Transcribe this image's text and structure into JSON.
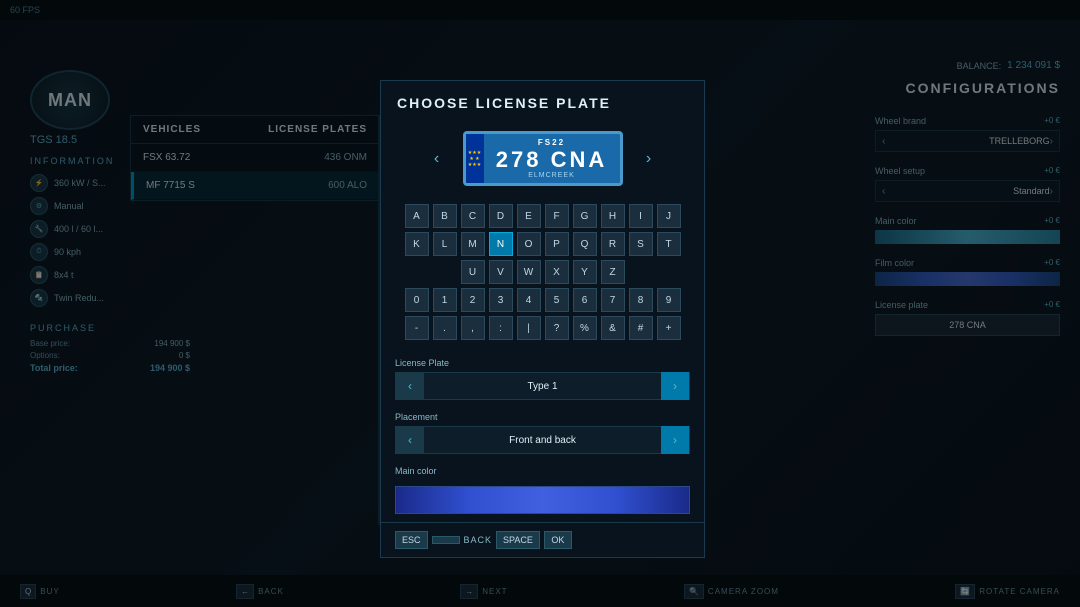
{
  "app": {
    "fps_label": "60 FPS"
  },
  "balance": {
    "label": "BALANCE:",
    "amount": "1 234 091 $"
  },
  "truck": {
    "brand": "MAN",
    "model": "TGS 18.5",
    "info_title": "INFORMATION",
    "specs": [
      {
        "icon": "⚡",
        "text": "360 kW / S..."
      },
      {
        "icon": "⚙",
        "text": "Manual"
      },
      {
        "icon": "🔧",
        "text": "400 l / 60 l..."
      },
      {
        "icon": "⏱",
        "text": "90 kph"
      },
      {
        "icon": "📋",
        "text": "8x4 t"
      },
      {
        "icon": "🔩",
        "text": "Twin Redu..."
      }
    ],
    "purchase_title": "PURCHASE",
    "base_price_label": "Base price:",
    "base_price_value": "194 900 $",
    "options_label": "Options:",
    "options_value": "0 $",
    "total_label": "Total price:",
    "total_value": "194 900 $"
  },
  "vehicles_panel": {
    "col_vehicles": "VEHICLES",
    "col_license_plates": "LICENSE PLATES",
    "rows": [
      {
        "name": "FSX 63.72",
        "plate": "436 ONM",
        "active": false
      },
      {
        "name": "MF 7715 S",
        "plate": "600 ALO",
        "active": true
      }
    ]
  },
  "modal": {
    "title": "CHOOSE LICENSE PLATE",
    "plate": {
      "top_text": "FS22",
      "number": "278 CNA",
      "bottom_text": "ELMCREEK",
      "eu_stars": "★★★\n★ ★\n★★★"
    },
    "keyboard": {
      "row1": [
        "A",
        "B",
        "C",
        "D",
        "E",
        "F",
        "G",
        "H",
        "I",
        "J"
      ],
      "row2": [
        "K",
        "L",
        "M",
        "N",
        "O",
        "P",
        "Q",
        "R",
        "S",
        "T"
      ],
      "row3": [
        "U",
        "V",
        "W",
        "X",
        "Y",
        "Z"
      ],
      "row4": [
        "0",
        "1",
        "2",
        "3",
        "4",
        "5",
        "6",
        "7",
        "8",
        "9"
      ],
      "row5": [
        "-",
        ".",
        ",",
        ":",
        "|",
        "?",
        "%",
        "&",
        "#",
        "+"
      ],
      "active_key": "N"
    },
    "license_plate_label": "License Plate",
    "license_plate_value": "Type 1",
    "placement_label": "Placement",
    "placement_value": "Front and back",
    "main_color_label": "Main color",
    "footer": {
      "esc_key": "ESC",
      "back_key": "BACK",
      "space_key": "SPACE",
      "ok_key": "OK"
    }
  },
  "configurations": {
    "title": "CONFIGURATIONS",
    "wheel_brand_label": "Wheel brand",
    "wheel_brand_price": "+0 €",
    "wheel_brand_value": "TRELLEBORG",
    "wheel_setup_label": "Wheel setup",
    "wheel_setup_price": "+0 €",
    "wheel_setup_value": "Standard",
    "main_color_label": "Main color",
    "main_color_price": "+0 €",
    "film_color_label": "Film color",
    "film_color_price": "+0 €",
    "license_plate_label": "License plate",
    "license_plate_price": "+0 €",
    "license_plate_value": "278 CNA"
  },
  "bottom_nav": [
    {
      "key": "Q",
      "label": "BUY"
    },
    {
      "key": "←",
      "label": "BACK"
    },
    {
      "key": "→",
      "label": "NEXT"
    },
    {
      "key": "🔍",
      "label": "CAMERA ZOOM"
    },
    {
      "key": "🔄",
      "label": "ROTATE CAMERA"
    }
  ]
}
